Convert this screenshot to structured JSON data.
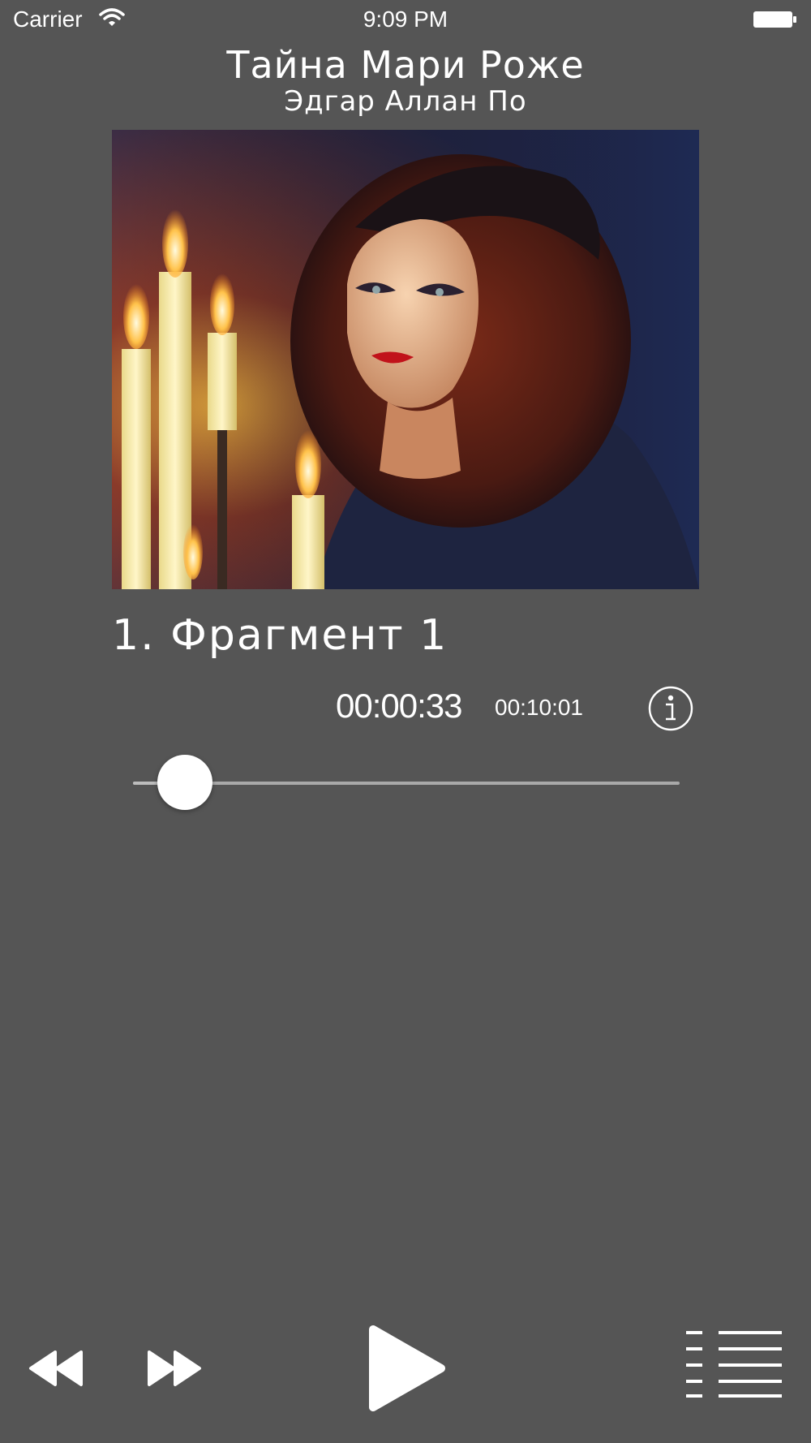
{
  "status_bar": {
    "carrier": "Carrier",
    "time": "9:09 PM"
  },
  "book": {
    "title": "Тайна Мари Роже",
    "author": "Эдгар Аллан По"
  },
  "track": {
    "chapter": "1. Фрагмент 1",
    "elapsed": "00:00:33",
    "duration": "00:10:01",
    "progress_fraction": 0.095
  },
  "icons": {
    "wifi": "wifi-icon",
    "battery": "battery-icon",
    "info": "info-icon",
    "rewind": "rewind-icon",
    "forward": "fast-forward-icon",
    "play": "play-icon",
    "playlist": "playlist-icon"
  },
  "colors": {
    "background": "#555555",
    "foreground": "#ffffff"
  }
}
